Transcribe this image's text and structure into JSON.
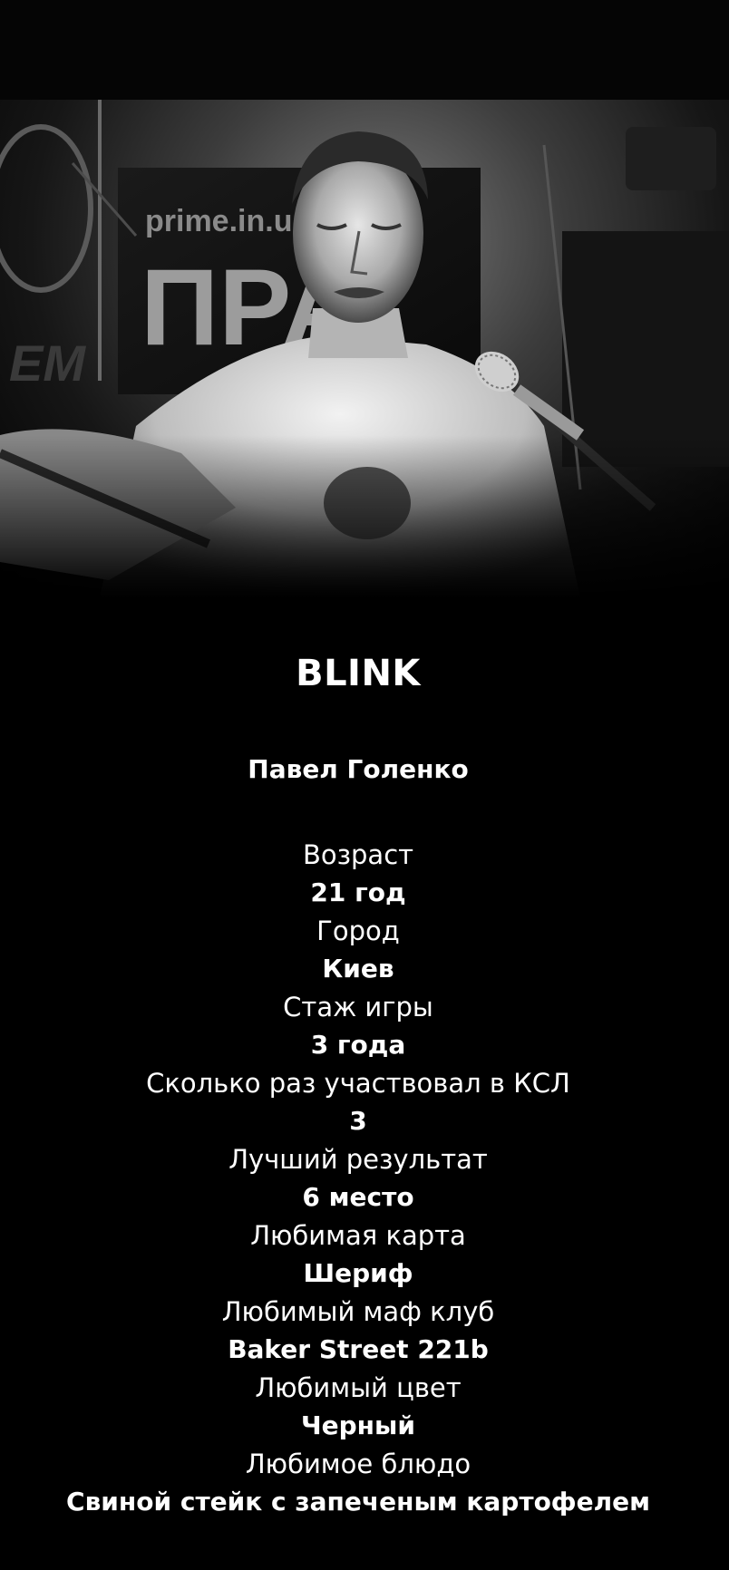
{
  "header_photo": {
    "alt": "",
    "banner_text": "prime.in.ua",
    "banner_letters": "ПРА",
    "left_sign": "EM"
  },
  "player": {
    "nickname": "BLINK",
    "full_name": "Павел Голенко"
  },
  "profile": [
    {
      "label": "Возраст",
      "value": "21 год"
    },
    {
      "label": "Город",
      "value": "Киев"
    },
    {
      "label": "Стаж игры",
      "value": "3 года"
    },
    {
      "label": "Сколько раз участвовал в КСЛ",
      "value": "3"
    },
    {
      "label": "Лучший результат",
      "value": "6 место"
    },
    {
      "label": "Любимая карта",
      "value": "Шериф"
    },
    {
      "label": "Любимый маф клуб",
      "value": "Baker Street 221b"
    },
    {
      "label": "Любимый цвет",
      "value": "Черный"
    },
    {
      "label": "Любимое блюдо",
      "value": "Свиной стейк с запеченым картофелем"
    }
  ]
}
